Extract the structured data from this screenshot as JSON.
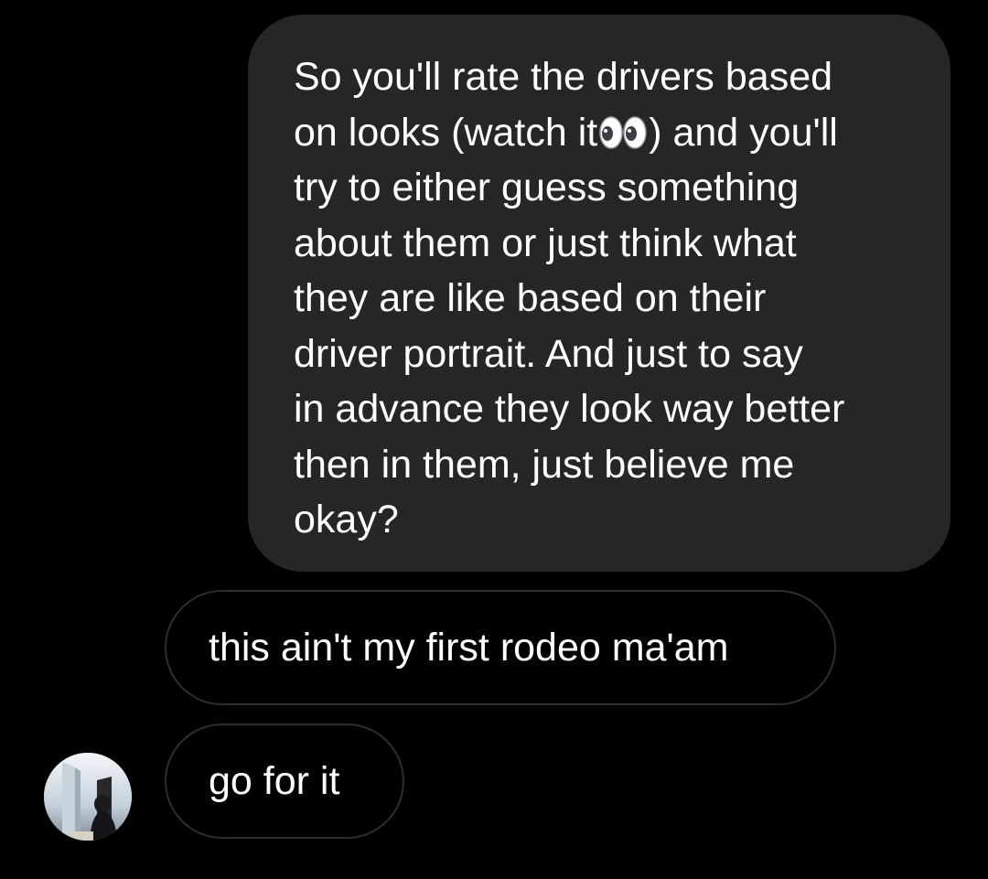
{
  "thread": {
    "messages": [
      {
        "direction": "sent",
        "text_before_emoji": "So you'll rate the drivers based\non looks (watch it",
        "emoji": "eyes-icon",
        "text_after_emoji": ") and you'll\ntry to either guess something\nabout them or just think what\nthey are like based on their\ndriver portrait. And just to say\nin advance they look way better\nthen in them, just believe me\nokay?"
      },
      {
        "direction": "received",
        "text": "this ain't my first rodeo ma'am"
      },
      {
        "direction": "received",
        "text": "go for it",
        "avatar": "contact-avatar"
      }
    ]
  },
  "colors": {
    "background": "#000000",
    "sent_bubble": "#262626",
    "received_bubble_border": "#2e2e2e",
    "text": "#ffffff"
  }
}
